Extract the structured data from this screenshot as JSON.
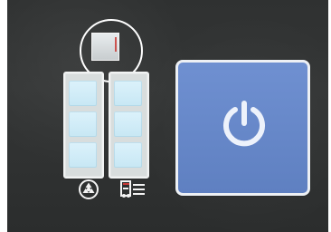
{
  "scene": {
    "type": "control-panel-photo"
  },
  "controls": {
    "top_indicator_icon": "square-indicator-icon",
    "left_icon": "radiation-icon",
    "right_icon": "printer-list-icon",
    "power_icon": "power-icon"
  },
  "colors": {
    "panel": "#313333",
    "segment": "#d6eef8",
    "power_button": "#6786c7",
    "outline": "#ffffff",
    "accent_red": "#c93935"
  }
}
